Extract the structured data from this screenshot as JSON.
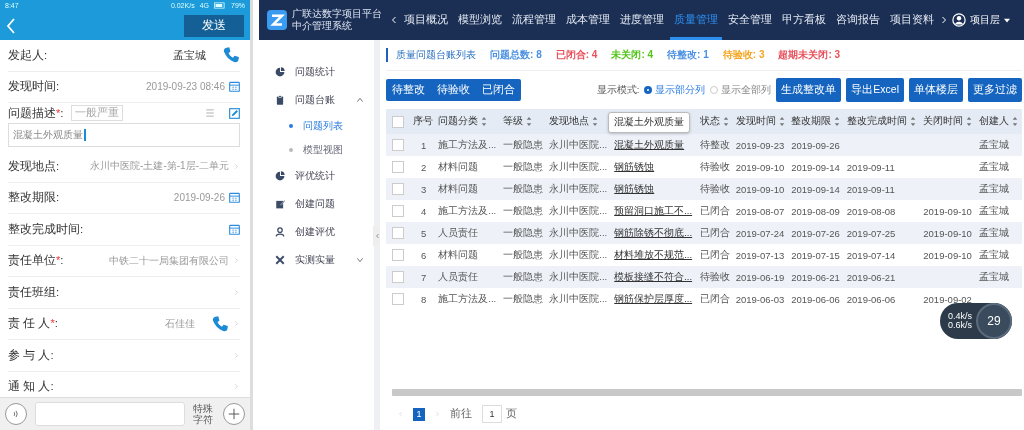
{
  "phone": {
    "status_bar": {
      "time": "8:47",
      "speed": "0.02K/s",
      "network": "4G",
      "battery": "79%"
    },
    "send_button": "发送",
    "fields": [
      {
        "kind": "contact",
        "label": "发起人:",
        "value": "孟宝城"
      },
      {
        "kind": "date",
        "label": "发现时间:",
        "value": "2019-09-23 08:46"
      },
      {
        "kind": "description",
        "label": "问题描述",
        "required": "*",
        "colon": ":",
        "tag": "一般严重",
        "value": "混凝土外观质量"
      },
      {
        "kind": "select",
        "label": "发现地点:",
        "value": "永川中医院-土建-第-1层-二单元"
      },
      {
        "kind": "date",
        "label": "整改期限:",
        "value": "2019-09-26"
      },
      {
        "kind": "date",
        "label": "整改完成时间:"
      },
      {
        "kind": "select",
        "label": "责任单位",
        "required": "*",
        "colon": ":",
        "value": "中铁二十一局集团有限公司"
      },
      {
        "kind": "select",
        "label": "责任班组:"
      },
      {
        "kind": "contact_select",
        "label": "责 任 人",
        "required": "*",
        "colon": ":",
        "value": "石佳佳"
      },
      {
        "kind": "select",
        "label": "参 与 人:"
      },
      {
        "kind": "select",
        "label": "通 知 人:"
      }
    ],
    "input_bar": {
      "special_chars": "特殊字符"
    }
  },
  "app": {
    "logo_title": "广联达数字项目平台",
    "logo_subtitle": "中介管理系统",
    "nav": [
      {
        "label": "项目概况",
        "selected": false
      },
      {
        "label": "模型浏览",
        "selected": false
      },
      {
        "label": "流程管理",
        "selected": false
      },
      {
        "label": "成本管理",
        "selected": false
      },
      {
        "label": "进度管理",
        "selected": false
      },
      {
        "label": "质量管理",
        "selected": true
      },
      {
        "label": "安全管理",
        "selected": false
      },
      {
        "label": "甲方看板",
        "selected": false
      },
      {
        "label": "咨询报告",
        "selected": false
      },
      {
        "label": "项目资料",
        "selected": false
      }
    ],
    "user_menu": "项目层",
    "sidebar": {
      "items": [
        {
          "label": "问题统计"
        },
        {
          "label": "问题台账",
          "expanded": true,
          "children": [
            {
              "label": "问题列表",
              "selected": true
            },
            {
              "label": "模型视图",
              "selected": false
            }
          ]
        },
        {
          "label": "评优统计"
        },
        {
          "label": "创建问题"
        },
        {
          "label": "创建评优"
        },
        {
          "label": "实测实量",
          "expanded": false
        }
      ]
    },
    "list_title": "质量问题台账列表",
    "stats": [
      {
        "label": "问题总数:",
        "value": "8",
        "color": "#4a90e2"
      },
      {
        "label": "已闭合:",
        "value": "4",
        "color": "#e8505b"
      },
      {
        "label": "未关闭:",
        "value": "4",
        "color": "#52c41a"
      },
      {
        "label": "待整改:",
        "value": "1",
        "color": "#4a90e2"
      },
      {
        "label": "待验收:",
        "value": "3",
        "color": "#f5a623"
      },
      {
        "label": "超期未关闭:",
        "value": "3",
        "color": "#e8505b"
      }
    ],
    "filter_tabs": [
      "待整改",
      "待验收",
      "已闭合"
    ],
    "display_mode": {
      "label": "显示模式:",
      "options": [
        {
          "label": "显示部分列",
          "selected": true
        },
        {
          "label": "显示全部列",
          "selected": false
        }
      ]
    },
    "actions": [
      "生成整改单",
      "导出Excel",
      "单体楼层",
      "更多过滤"
    ],
    "table": {
      "header_checked": false,
      "columns": [
        {
          "label": "序号",
          "sortable": false,
          "kind": "number"
        },
        {
          "label": "问题分类",
          "sortable": true,
          "kind": "text"
        },
        {
          "label": "等级",
          "sortable": true,
          "kind": "text"
        },
        {
          "label": "发现地点",
          "sortable": true,
          "kind": "text"
        },
        {
          "kind": "link",
          "sortable": false
        },
        {
          "label": "状态",
          "sortable": true,
          "kind": "text"
        },
        {
          "label": "发现时间",
          "sortable": true,
          "kind": "text"
        },
        {
          "label": "整改期限",
          "sortable": true,
          "kind": "text"
        },
        {
          "label": "整改完成时间",
          "sortable": true,
          "kind": "text"
        },
        {
          "label": "关闭时间",
          "sortable": true,
          "kind": "text"
        },
        {
          "label": "创建人",
          "sortable": true,
          "kind": "text"
        }
      ],
      "tooltip": "混凝土外观质量",
      "rows": [
        {
          "checked": false,
          "cells": [
            "1",
            "施工方法及...",
            "一般隐患",
            "永川中医院...",
            "混凝土外观质量",
            "待整改",
            "2019-09-23",
            "2019-09-26",
            null,
            null,
            "孟宝城"
          ]
        },
        {
          "checked": false,
          "cells": [
            "2",
            "材料问题",
            "一般隐患",
            "永川中医院...",
            "钢筋锈蚀",
            "待验收",
            "2019-09-10",
            "2019-09-14",
            "2019-09-11",
            null,
            "孟宝城"
          ]
        },
        {
          "checked": false,
          "cells": [
            "3",
            "材料问题",
            "一般隐患",
            "永川中医院...",
            "钢筋锈蚀",
            "待验收",
            "2019-09-10",
            "2019-09-14",
            "2019-09-11",
            null,
            "孟宝城"
          ]
        },
        {
          "checked": false,
          "cells": [
            "4",
            "施工方法及...",
            "一般隐患",
            "永川中医院...",
            "预留洞口施工不...",
            "已闭合",
            "2019-08-07",
            "2019-08-09",
            "2019-08-08",
            "2019-09-10",
            "孟宝城"
          ]
        },
        {
          "checked": false,
          "cells": [
            "5",
            "人员责任",
            "一般隐患",
            "永川中医院...",
            "钢筋除锈不彻底...",
            "已闭合",
            "2019-07-24",
            "2019-07-26",
            "2019-07-25",
            "2019-09-10",
            "孟宝城"
          ]
        },
        {
          "checked": false,
          "cells": [
            "6",
            "材料问题",
            "一般隐患",
            "永川中医院...",
            "材料堆放不规范...",
            "已闭合",
            "2019-07-13",
            "2019-07-15",
            "2019-07-14",
            "2019-09-10",
            "孟宝城"
          ]
        },
        {
          "checked": false,
          "cells": [
            "7",
            "人员责任",
            "一般隐患",
            "永川中医院...",
            "模板接缝不符合...",
            "待验收",
            "2019-06-19",
            "2019-06-21",
            "2019-06-21",
            null,
            "孟宝城"
          ]
        },
        {
          "checked": false,
          "cells": [
            "8",
            "施工方法及...",
            "一般隐患",
            "永川中医院...",
            "钢筋保护层厚度...",
            "已闭合",
            "2019-06-03",
            "2019-06-06",
            "2019-06-06",
            "2019-09-02"
          ]
        }
      ]
    },
    "pagination": {
      "pages": [
        {
          "label": "1",
          "selected": true
        }
      ],
      "goto_label": "前往",
      "goto_value": "1",
      "page_suffix": "页"
    },
    "net_monitor": {
      "up": "0.4k/s",
      "down": "0.6k/s",
      "value": "29"
    }
  }
}
